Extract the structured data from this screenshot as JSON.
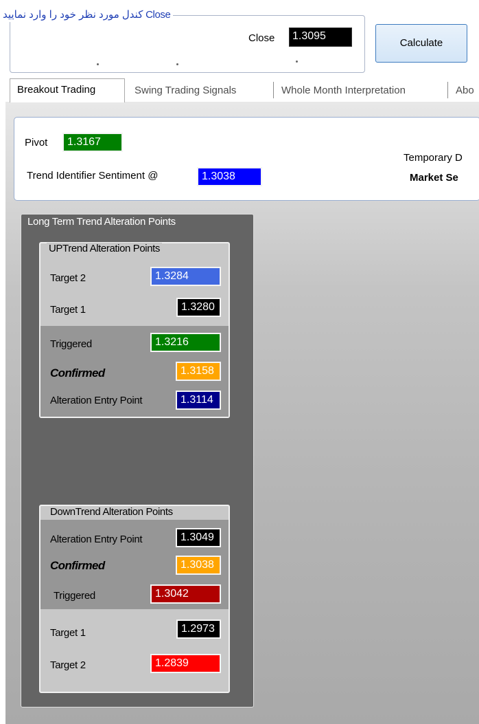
{
  "close_group": {
    "legend": "Close کندل مورد نظر خود را وارد نمایید",
    "close_label": "Close",
    "close_value": "1.3095",
    "calculate_label": "Calculate"
  },
  "tabs": [
    {
      "label": "Breakout Trading",
      "active": true
    },
    {
      "label": "Swing Trading Signals",
      "active": false
    },
    {
      "label": "Whole Month Interpretation",
      "active": false
    },
    {
      "label": "Abo",
      "active": false
    }
  ],
  "pivot_panel": {
    "pivot_label": "Pivot",
    "pivot_value": "1.3167",
    "temporary_label": "Temporary D",
    "trend_label": "Trend Identifier Sentiment @",
    "trend_value": "1.3038",
    "market_label": "Market Se"
  },
  "long_term": {
    "legend": "Long Term Trend Alteration Points",
    "uptrend": {
      "legend": "UPTrend Alteration Points",
      "rows": [
        {
          "label": "Target 2",
          "value": "1.3284"
        },
        {
          "label": "Target 1",
          "value": "1.3280"
        },
        {
          "label": "Triggered",
          "value": "1.3216"
        },
        {
          "label": "Confirmed",
          "value": "1.3158"
        },
        {
          "label": "Alteration Entry Point",
          "value": "1.3114"
        }
      ]
    },
    "downtrend": {
      "legend": "DownTrend Alteration Points",
      "rows": [
        {
          "label": "Alteration Entry Point",
          "value": "1.3049"
        },
        {
          "label": "Confirmed",
          "value": "1.3038"
        },
        {
          "label": "Triggered",
          "value": "1.3042"
        },
        {
          "label": "Target 1",
          "value": "1.2973"
        },
        {
          "label": "Target 2",
          "value": "1.2839"
        }
      ]
    }
  },
  "colors": {
    "green": "#008000",
    "blue": "#0000ff",
    "royal_blue": "#4169e1",
    "black": "#000000",
    "orange": "#ffa500",
    "navy": "#00008b",
    "dark_red": "#b00000",
    "red": "#ff0000"
  }
}
